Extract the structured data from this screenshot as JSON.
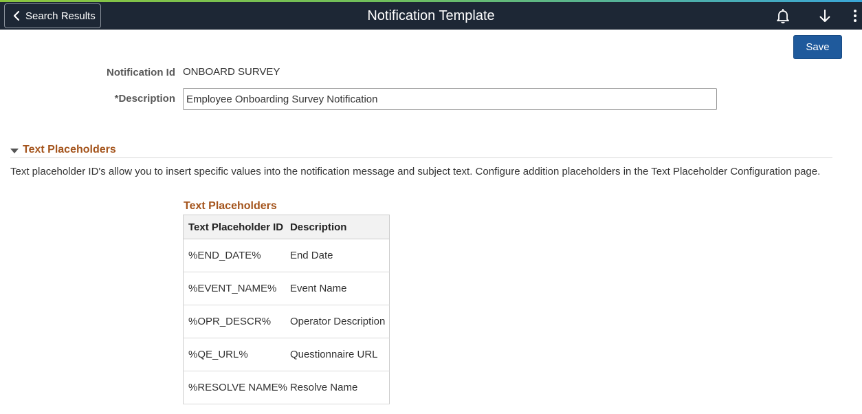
{
  "header": {
    "back_label": "Search Results",
    "title": "Notification Template",
    "icons": [
      "chevron-left-icon",
      "bell-icon",
      "download-arrow-icon",
      "more-vertical-icon"
    ]
  },
  "toolbar": {
    "save_label": "Save"
  },
  "form": {
    "notification_id_label": "Notification Id",
    "notification_id_value": "ONBOARD SURVEY",
    "description_label": "*Description",
    "description_value": "Employee Onboarding Survey Notification"
  },
  "section": {
    "title": "Text Placeholders",
    "help_text": "Text placeholder ID's allow you to insert specific values into the notification message and subject text. Configure addition placeholders in the Text Placeholder Configuration page."
  },
  "grid": {
    "title": "Text Placeholders",
    "columns": [
      "Text Placeholder ID",
      "Description"
    ],
    "rows": [
      [
        "%END_DATE%",
        "End Date"
      ],
      [
        "%EVENT_NAME%",
        "Event Name"
      ],
      [
        "%OPR_DESCR%",
        "Operator Description"
      ],
      [
        "%QE_URL%",
        "Questionnaire URL"
      ],
      [
        "%RESOLVE NAME%",
        "Resolve Name"
      ]
    ]
  },
  "colors": {
    "banner": "#1d2735",
    "accent_orange": "#a4541c",
    "save_blue": "#1f5a9c"
  }
}
